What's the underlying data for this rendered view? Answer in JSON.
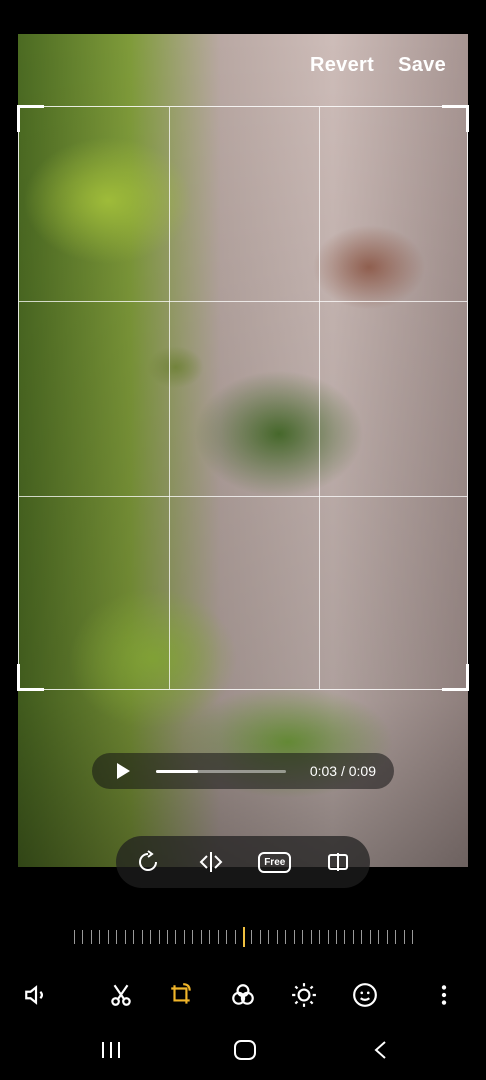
{
  "header": {
    "revert_label": "Revert",
    "save_label": "Save"
  },
  "playback": {
    "time": "0:03 / 0:09",
    "progress_fraction": 0.32
  },
  "crop_tools": {
    "free_label": "Free",
    "items": [
      "rotate-icon",
      "flip-horizontal-icon",
      "free-aspect-icon",
      "transform-icon"
    ]
  },
  "bottom_toolbar": {
    "items": [
      "volume-icon",
      "scissors-icon",
      "crop-rotate-icon",
      "filters-icon",
      "brightness-icon",
      "sticker-icon",
      "more-options-icon"
    ],
    "active": "crop-rotate-icon",
    "accent_color": "#f0b52a"
  },
  "system_nav": {
    "items": [
      "recents-icon",
      "home-icon",
      "back-icon"
    ]
  }
}
